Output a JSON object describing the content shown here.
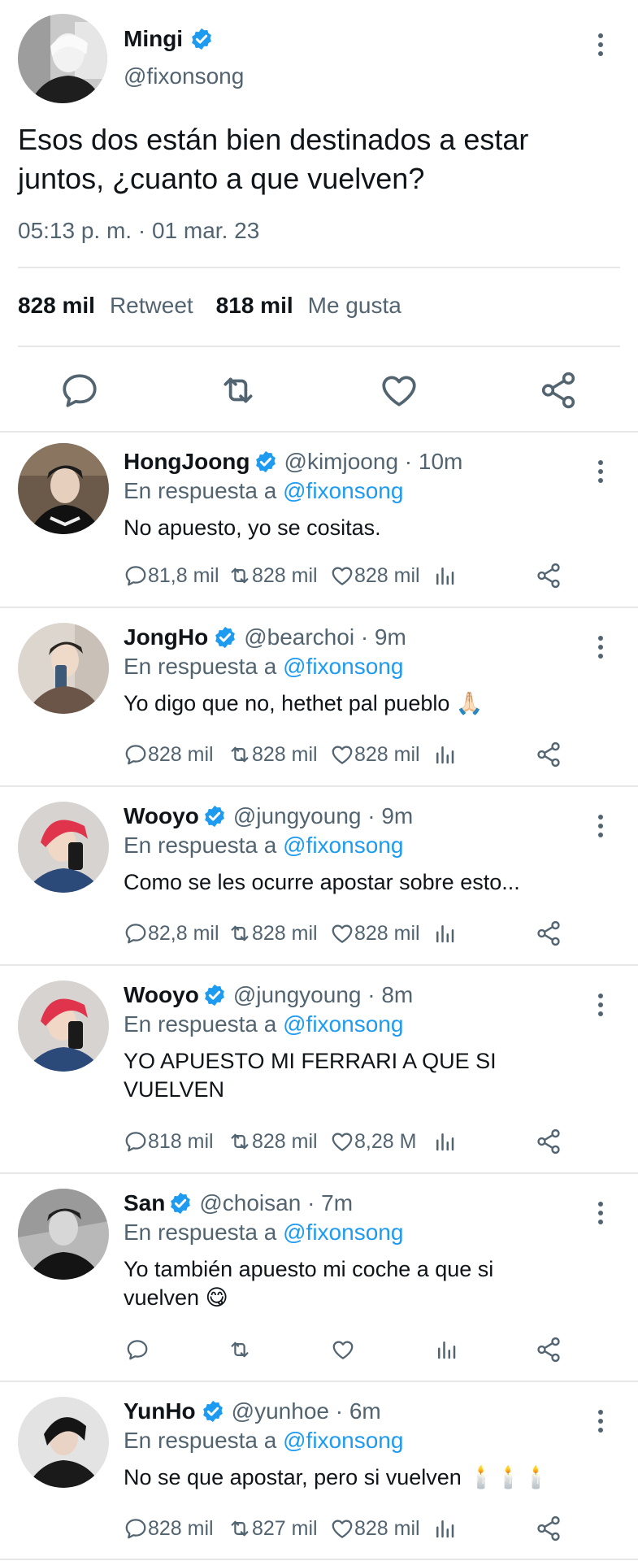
{
  "main_tweet": {
    "author_name": "Mingi",
    "author_handle": "@fixonsong",
    "text": "Esos dos están bien destinados a estar juntos, ¿cuanto a que vuelven?",
    "timestamp": "05:13 p. m. · 01 mar. 23",
    "retweets_count": "828 mil",
    "retweets_label": "Retweet",
    "likes_count": "818 mil",
    "likes_label": "Me gusta"
  },
  "reply_prefix": "En respuesta a",
  "reply_mention": "@fixonsong",
  "replies": [
    {
      "name": "HongJoong",
      "meta": "@kimjoong · 10m",
      "text": "No apuesto, yo se cositas.",
      "replies": "81,8 mil",
      "retweets": "828 mil",
      "likes": "828 mil"
    },
    {
      "name": "JongHo",
      "meta": "@bearchoi · 9m",
      "text": "Yo digo que no, hethet pal pueblo 🙏🏻",
      "replies": "828 mil",
      "retweets": "828 mil",
      "likes": "828 mil"
    },
    {
      "name": "Wooyo",
      "meta": "@jungyoung · 9m",
      "text": "Como se les ocurre apostar sobre esto...",
      "replies": "82,8 mil",
      "retweets": "828 mil",
      "likes": "828 mil"
    },
    {
      "name": "Wooyo",
      "meta": "@jungyoung · 8m",
      "text": "YO APUESTO MI FERRARI A QUE SI VUELVEN",
      "replies": "818 mil",
      "retweets": "828 mil",
      "likes": "8,28 M"
    },
    {
      "name": "San",
      "meta": "@choisan · 7m",
      "text": "Yo también apuesto mi coche a que si vuelven 😋",
      "replies": "",
      "retweets": "",
      "likes": ""
    },
    {
      "name": "YunHo",
      "meta": "@yunhoe · 6m",
      "text": "No se que apostar, pero si vuelven 🕯️🕯️🕯️",
      "replies": "828 mil",
      "retweets": "827 mil",
      "likes": "828 mil"
    }
  ],
  "colors": {
    "accent": "#1d9bf0",
    "secondary_text": "#536471",
    "divider": "#e7e7e7"
  },
  "icons": [
    "verified-badge-icon",
    "more-icon",
    "reply-icon",
    "retweet-icon",
    "like-icon",
    "share-icon",
    "views-icon"
  ]
}
